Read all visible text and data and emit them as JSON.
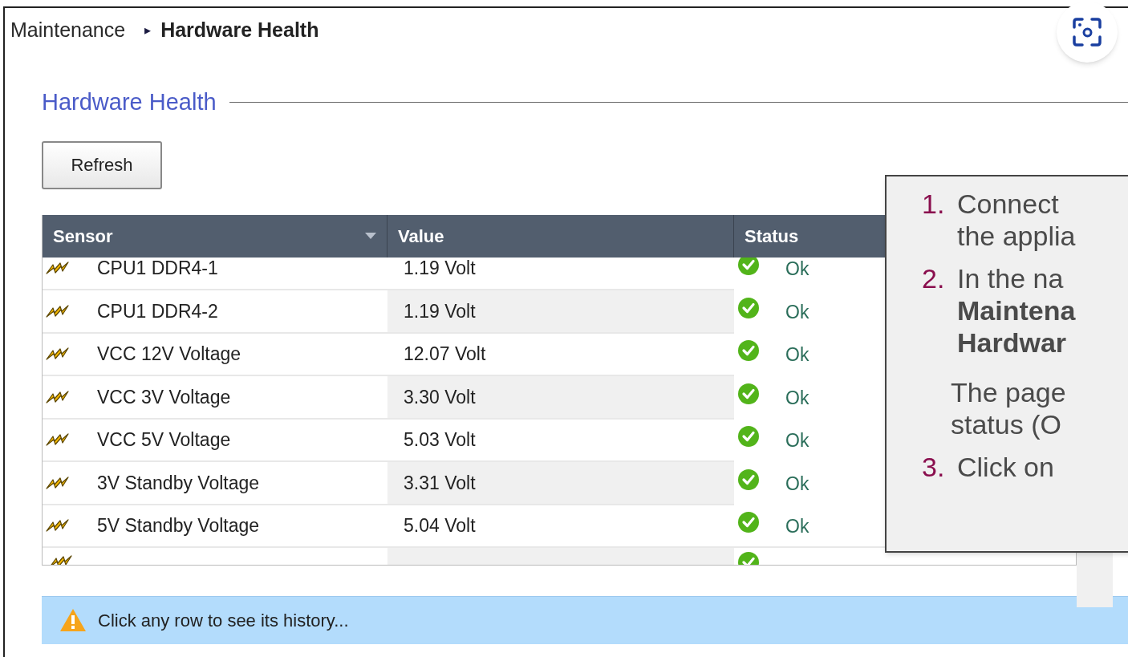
{
  "breadcrumb": {
    "parent": "Maintenance",
    "separator": "▸",
    "current": "Hardware Health"
  },
  "section": {
    "title": "Hardware Health"
  },
  "refresh_button": {
    "label": "Refresh"
  },
  "table": {
    "columns": [
      {
        "label": "Sensor",
        "sortable": true
      },
      {
        "label": "Value",
        "sortable": false
      },
      {
        "label": "Status",
        "sortable": false
      }
    ],
    "rows": [
      {
        "sensor": "CPU1 DDR4-1",
        "value": "1.19 Volt",
        "status": "Ok",
        "kind": "ok"
      },
      {
        "sensor": "CPU1 DDR4-2",
        "value": "1.19 Volt",
        "status": "Ok",
        "kind": "ok"
      },
      {
        "sensor": "VCC 12V Voltage",
        "value": "12.07 Volt",
        "status": "Ok",
        "kind": "ok"
      },
      {
        "sensor": "VCC 3V Voltage",
        "value": "3.30 Volt",
        "status": "Ok",
        "kind": "ok"
      },
      {
        "sensor": "VCC 5V Voltage",
        "value": "5.03 Volt",
        "status": "Ok",
        "kind": "ok"
      },
      {
        "sensor": "3V Standby Voltage",
        "value": "3.31 Volt",
        "status": "Ok",
        "kind": "ok"
      },
      {
        "sensor": "5V Standby Voltage",
        "value": "5.04 Volt",
        "status": "Ok",
        "kind": "ok"
      }
    ]
  },
  "info_bar": {
    "text": "Click any row to see its history..."
  },
  "instructions": {
    "steps": [
      {
        "number": "1.",
        "lines": [
          {
            "text": "Connect",
            "bold": false
          },
          {
            "text": "the applia",
            "bold": false
          }
        ]
      },
      {
        "number": "2.",
        "lines": [
          {
            "text": "In the na",
            "bold": false
          },
          {
            "text": "Maintena",
            "bold": true
          },
          {
            "text": "Hardwar",
            "bold": true
          }
        ],
        "note": [
          "The page",
          "status (O"
        ]
      },
      {
        "number": "3.",
        "lines": [
          {
            "text": "Click on",
            "bold": false
          }
        ]
      }
    ]
  }
}
